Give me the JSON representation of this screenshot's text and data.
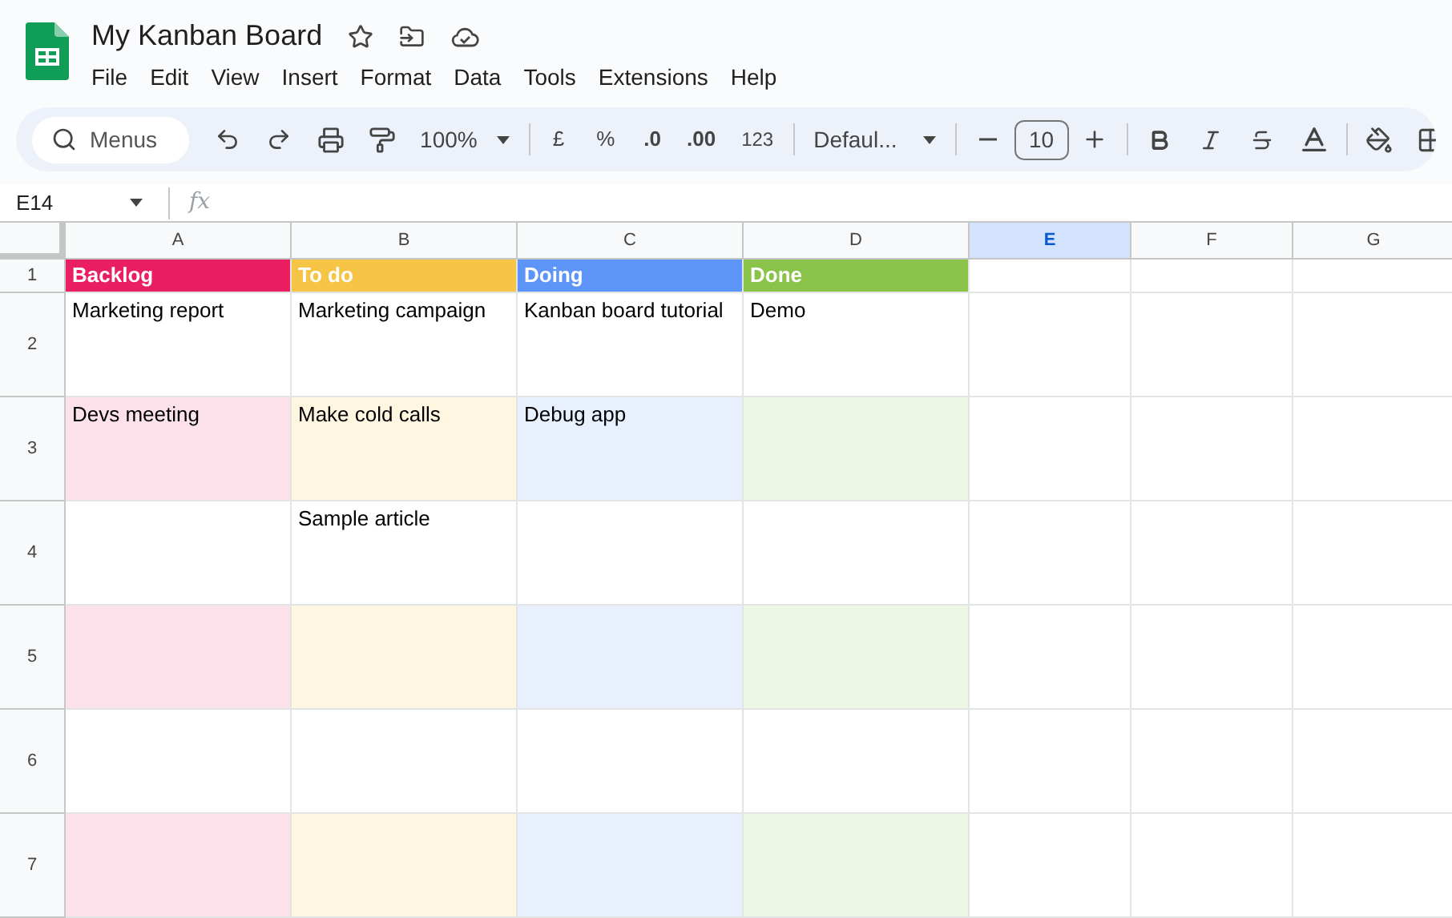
{
  "document": {
    "title": "My Kanban Board"
  },
  "menu_bar": [
    "File",
    "Edit",
    "View",
    "Insert",
    "Format",
    "Data",
    "Tools",
    "Extensions",
    "Help"
  ],
  "toolbar": {
    "search": {
      "placeholder": "Menus"
    },
    "zoom": "100%",
    "currency": "£",
    "percent": "%",
    "decrease_decimals": ".0",
    "increase_decimals": ".00",
    "number_format": "123",
    "font": "Defaul...",
    "font_size": "10"
  },
  "formula_bar": {
    "name_box": "E14",
    "function_label": "fx"
  },
  "columns": [
    {
      "label": "A",
      "selected": false
    },
    {
      "label": "B",
      "selected": false
    },
    {
      "label": "C",
      "selected": false
    },
    {
      "label": "D",
      "selected": false
    },
    {
      "label": "E",
      "selected": true
    },
    {
      "label": "F",
      "selected": false
    },
    {
      "label": "G",
      "selected": false
    }
  ],
  "board_columns": [
    {
      "title": "Backlog",
      "color": "#e91e63",
      "band": {
        "color": "#fce1ea"
      }
    },
    {
      "title": "To do",
      "color": "#f7c546",
      "band": {
        "color": "#fef6e1"
      }
    },
    {
      "title": "Doing",
      "color": "#5c95f7",
      "band": {
        "color": "#e8f0fd"
      }
    },
    {
      "title": "Done",
      "color": "#8bc34a",
      "band": {
        "color": "#eef6e4"
      }
    }
  ],
  "rows": [
    {
      "number": "1",
      "kind": "header"
    },
    {
      "number": "2",
      "kind": "tasks",
      "shaded": false,
      "cells": [
        {
          "text": "Marketing report"
        },
        {
          "text": "Marketing campaign"
        },
        {
          "text": "Kanban board tutorial"
        },
        {
          "text": "Demo"
        }
      ]
    },
    {
      "number": "3",
      "kind": "tasks",
      "shaded": true,
      "cells": [
        {
          "text": "Devs meeting"
        },
        {
          "text": "Make cold calls"
        },
        {
          "text": "Debug app"
        },
        {}
      ]
    },
    {
      "number": "4",
      "kind": "tasks",
      "shaded": false,
      "cells": [
        {},
        {
          "text": "Sample article"
        },
        {},
        {}
      ]
    },
    {
      "number": "5",
      "kind": "tasks",
      "shaded": true,
      "cells": [
        {},
        {},
        {},
        {}
      ]
    },
    {
      "number": "6",
      "kind": "tasks",
      "shaded": false,
      "cells": [
        {},
        {},
        {},
        {}
      ]
    },
    {
      "number": "7",
      "kind": "tasks",
      "shaded": true,
      "cells": [
        {},
        {},
        {},
        {}
      ]
    }
  ]
}
